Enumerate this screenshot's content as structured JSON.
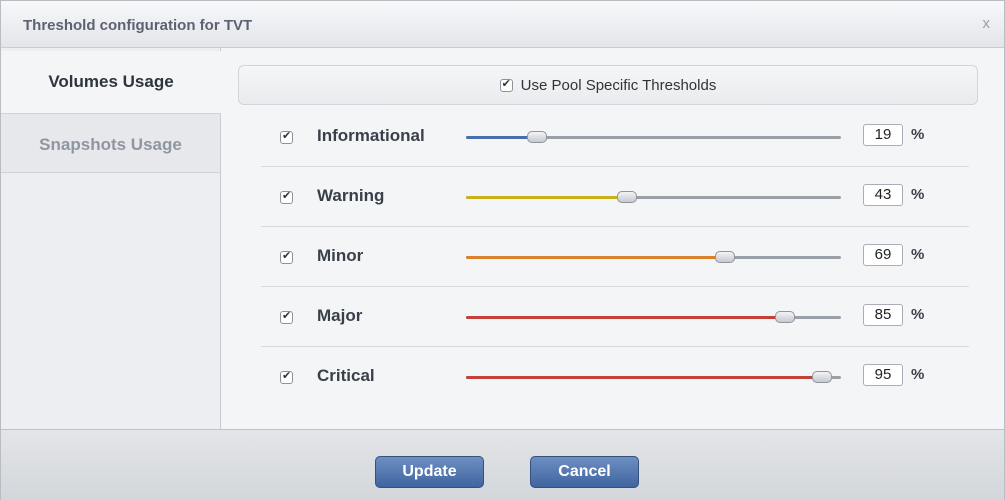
{
  "dialog": {
    "title": "Threshold configuration for TVT",
    "close_glyph": "x"
  },
  "tabs": [
    {
      "label": "Volumes Usage",
      "active": true
    },
    {
      "label": "Snapshots Usage",
      "active": false
    }
  ],
  "pool": {
    "label": "Use Pool Specific Thresholds",
    "checked": true
  },
  "thresholds": [
    {
      "label": "Informational",
      "checked": true,
      "value": "19",
      "level": 19,
      "unit": "%",
      "color": "#4a6fb0"
    },
    {
      "label": "Warning",
      "checked": true,
      "value": "43",
      "level": 43,
      "unit": "%",
      "color": "#c9b21a"
    },
    {
      "label": "Minor",
      "checked": true,
      "value": "69",
      "level": 69,
      "unit": "%",
      "color": "#d9822b"
    },
    {
      "label": "Major",
      "checked": true,
      "value": "85",
      "level": 85,
      "unit": "%",
      "color": "#c4403b"
    },
    {
      "label": "Critical",
      "checked": true,
      "value": "95",
      "level": 95,
      "unit": "%",
      "color": "#c4403b"
    }
  ],
  "buttons": {
    "update": "Update",
    "cancel": "Cancel"
  }
}
